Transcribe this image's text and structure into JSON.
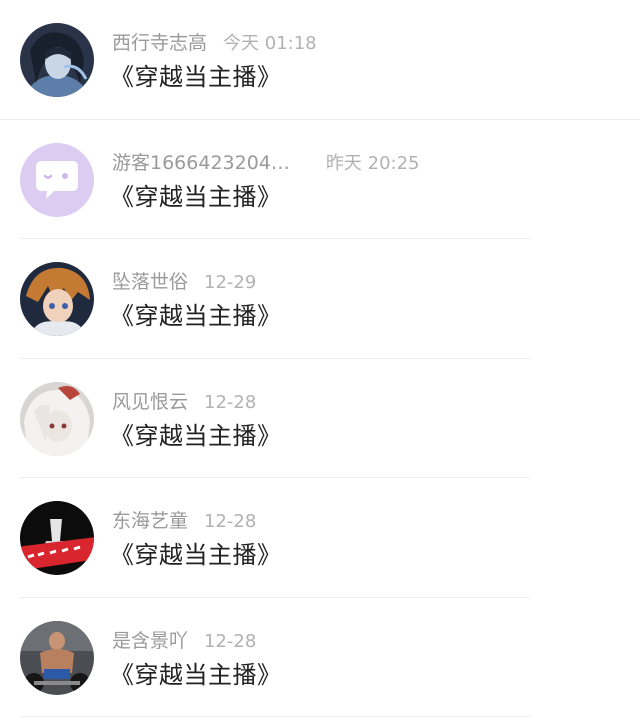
{
  "comments": [
    {
      "username": "西行寺志高",
      "time": "今天 01:18",
      "text": "《穿越当主播》",
      "avatar_icon": "anime-avatar-icon"
    },
    {
      "username": "游客1666423204…",
      "time": "昨天 20:25",
      "text": "《穿越当主播》",
      "avatar_icon": "default-chat-avatar-icon"
    },
    {
      "username": "坠落世俗",
      "time": "12-29",
      "text": "《穿越当主播》",
      "avatar_icon": "anime-avatar-icon"
    },
    {
      "username": "风见恨云",
      "time": "12-28",
      "text": "《穿越当主播》",
      "avatar_icon": "anime-avatar-icon"
    },
    {
      "username": "东海艺童",
      "time": "12-28",
      "text": "《穿越当主播》",
      "avatar_icon": "photo-avatar-icon"
    },
    {
      "username": "是含景吖",
      "time": "12-28",
      "text": "《穿越当主播》",
      "avatar_icon": "photo-avatar-icon"
    }
  ],
  "colors": {
    "username": "#9a9a9a",
    "time": "#b2b2b2",
    "text": "#222222",
    "divider": "#eeeeee",
    "default_avatar_bg": "#d9c8f0"
  }
}
